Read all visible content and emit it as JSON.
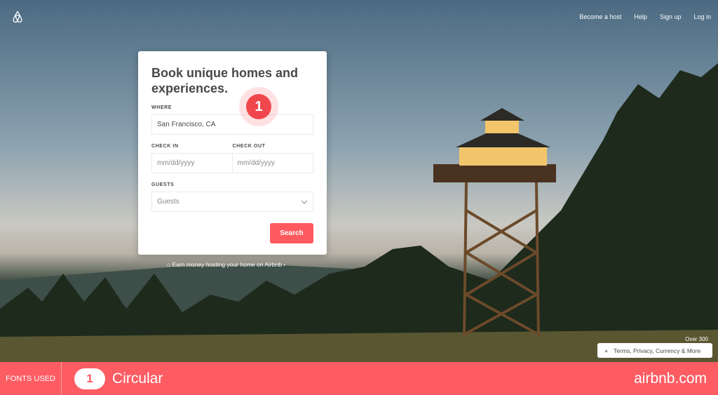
{
  "nav": {
    "become_host": "Become a host",
    "help": "Help",
    "sign_up": "Sign up",
    "log_in": "Log in"
  },
  "card": {
    "title": "Book unique homes and experiences.",
    "where_label": "WHERE",
    "where_value": "San Francisco, CA",
    "checkin_label": "CHECK IN",
    "checkin_placeholder": "mm/dd/yyyy",
    "checkout_label": "CHECK OUT",
    "checkout_placeholder": "mm/dd/yyyy",
    "guests_label": "GUESTS",
    "guests_value": "Guests",
    "search_label": "Search"
  },
  "annotation_badge": "1",
  "earn_link": "Earn money hosting your home on Airbnb ›",
  "over_text": "Over 300",
  "terms": "Terms, Privacy, Currency & More",
  "footer": {
    "fonts_used": "FONTS USED",
    "font_number": "1",
    "font_name": "Circular",
    "site": "airbnb.com"
  },
  "colors": {
    "brand": "#ff5a5f",
    "footer": "#fd5c63"
  }
}
